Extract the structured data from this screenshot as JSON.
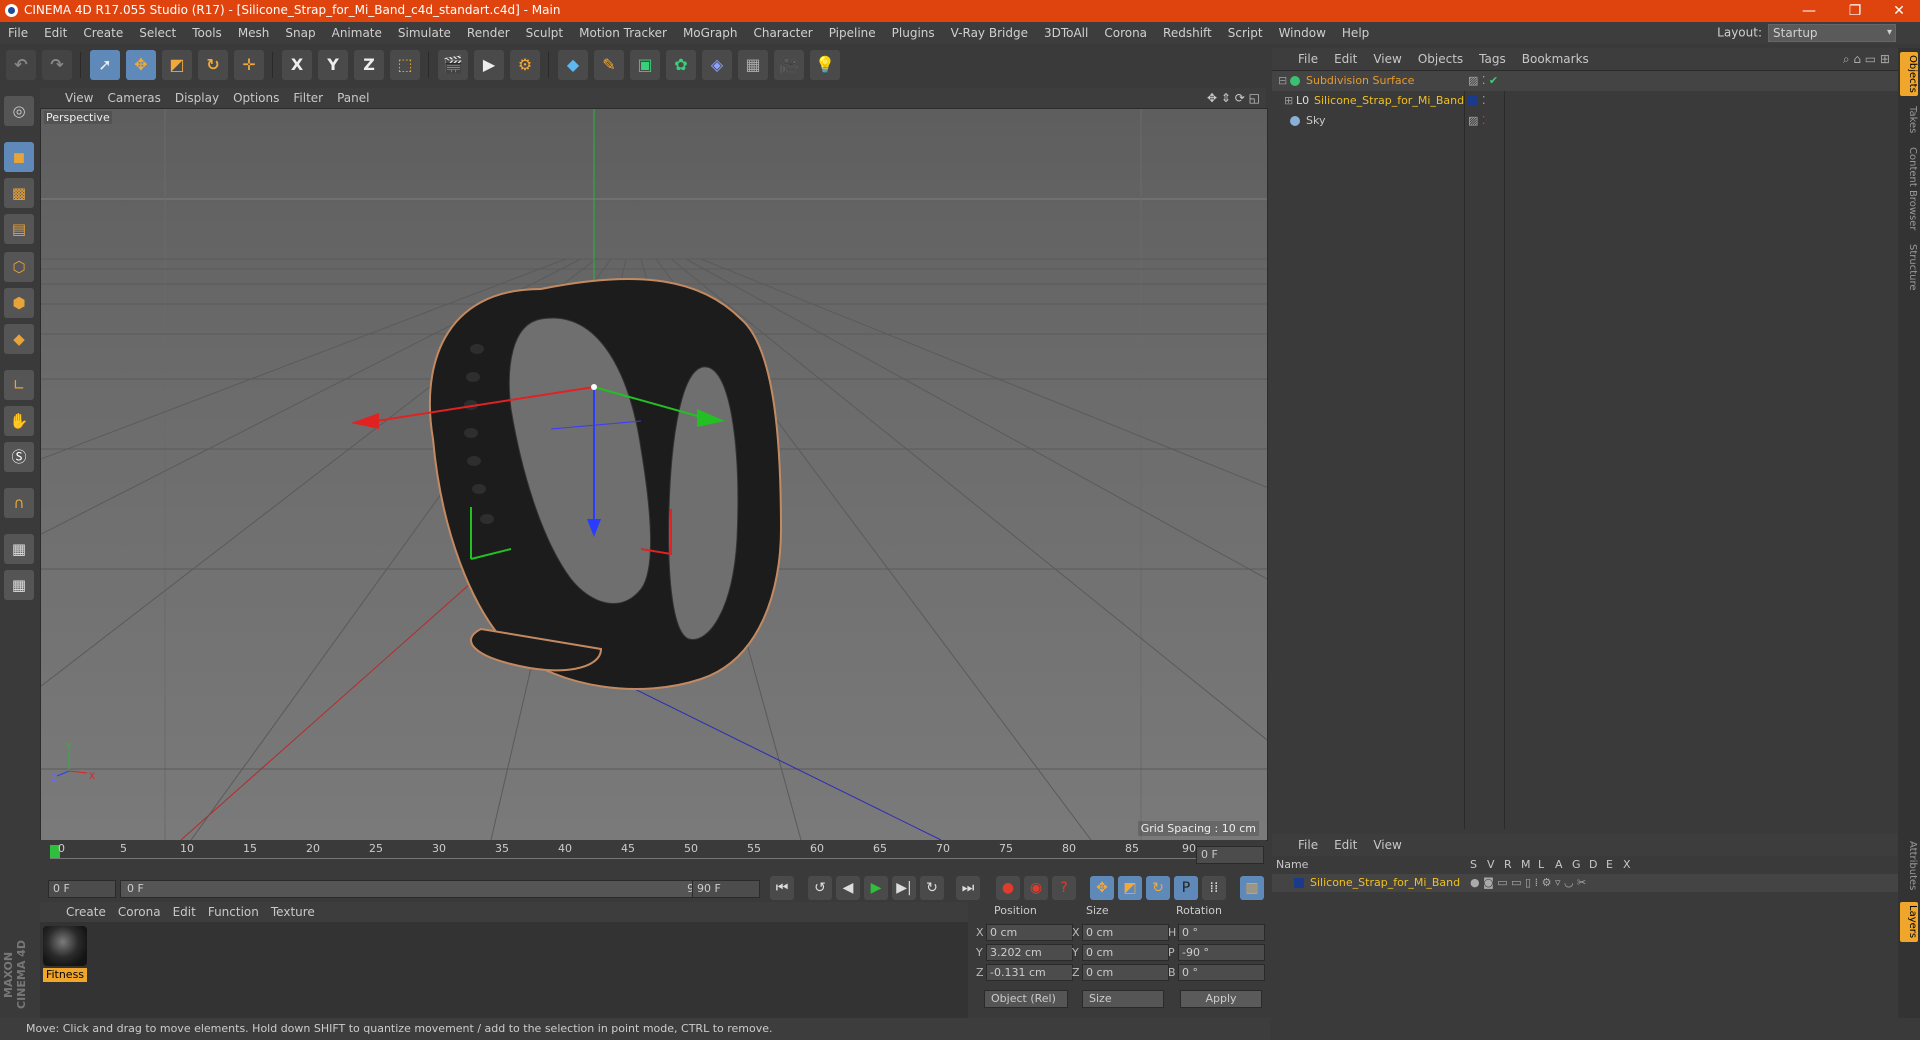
{
  "window": {
    "title": "CINEMA 4D R17.055 Studio (R17) - [Silicone_Strap_for_Mi_Band_c4d_standart.c4d] - Main",
    "controls": [
      "—",
      "❐",
      "✕"
    ]
  },
  "menubar": {
    "items": [
      "File",
      "Edit",
      "Create",
      "Select",
      "Tools",
      "Mesh",
      "Snap",
      "Animate",
      "Simulate",
      "Render",
      "Sculpt",
      "Motion Tracker",
      "MoGraph",
      "Character",
      "Pipeline",
      "Plugins",
      "V-Ray Bridge",
      "3DToAll",
      "Corona",
      "Redshift",
      "Script",
      "Window",
      "Help"
    ],
    "layout_label": "Layout:",
    "layout_value": "Startup"
  },
  "toolbar": {
    "icons": [
      "undo-icon",
      "redo-icon",
      "live-selection-icon",
      "move-icon",
      "scale-icon",
      "rotate-icon",
      "recent-tool-icon",
      "x-axis-icon",
      "y-axis-icon",
      "z-axis-icon",
      "world-coords-icon",
      "render-view-icon",
      "render-picture-viewer-icon",
      "edit-render-settings-icon",
      "cube-icon",
      "pen-spline-icon",
      "subdivision-icon",
      "array-icon",
      "deformer-icon",
      "floor-icon",
      "camera-icon",
      "light-icon"
    ],
    "axis_labels": [
      "X",
      "Y",
      "Z"
    ]
  },
  "viewport": {
    "menu": [
      "View",
      "Cameras",
      "Display",
      "Options",
      "Filter",
      "Panel"
    ],
    "camera_label": "Perspective",
    "grid_spacing": "Grid Spacing : 10 cm",
    "axis_labels": {
      "y": "Y",
      "x": "X",
      "z": "Z"
    }
  },
  "timeline": {
    "ticks": [
      "0",
      "5",
      "10",
      "15",
      "20",
      "25",
      "30",
      "35",
      "40",
      "45",
      "50",
      "55",
      "60",
      "65",
      "70",
      "75",
      "80",
      "85",
      "90"
    ],
    "current_frame": "0 F",
    "start_field": "0 F",
    "range_start": "0 F",
    "range_end": "90 F",
    "end_field": "90 F"
  },
  "materials": {
    "menu": [
      "Create",
      "Corona",
      "Edit",
      "Function",
      "Texture"
    ],
    "items": [
      {
        "name": "Fitness"
      }
    ]
  },
  "coordinates": {
    "headers": {
      "position": "Position",
      "size": "Size",
      "rotation": "Rotation"
    },
    "rows": [
      {
        "axis": "X",
        "pos": "0 cm",
        "size_axis": "X",
        "size": "0 cm",
        "rot_axis": "H",
        "rot": "0 °"
      },
      {
        "axis": "Y",
        "pos": "3.202 cm",
        "size_axis": "Y",
        "size": "0 cm",
        "rot_axis": "P",
        "rot": "-90 °"
      },
      {
        "axis": "Z",
        "pos": "-0.131 cm",
        "size_axis": "Z",
        "size": "0 cm",
        "rot_axis": "B",
        "rot": "0 °"
      }
    ],
    "mode": "Object (Rel)",
    "size_mode": "Size",
    "apply": "Apply"
  },
  "status": "Move: Click and drag to move elements. Hold down SHIFT to quantize movement / add to the selection in point mode, CTRL to remove.",
  "object_manager": {
    "menu": [
      "File",
      "Edit",
      "View",
      "Objects",
      "Tags",
      "Bookmarks"
    ],
    "objects": [
      {
        "name": "Subdivision Surface",
        "color": "#e89a2a"
      },
      {
        "name": "Silicone_Strap_for_Mi_Band",
        "color": "#f0c020"
      },
      {
        "name": "Sky",
        "color": "#c8c8c8"
      }
    ]
  },
  "layer_manager": {
    "menu": [
      "File",
      "Edit",
      "View"
    ],
    "columns": [
      "Name",
      "S",
      "V",
      "R",
      "M",
      "L",
      "A",
      "G",
      "D",
      "E",
      "X"
    ],
    "layers": [
      {
        "name": "Silicone_Strap_for_Mi_Band",
        "color": "#1c3a8a"
      }
    ]
  },
  "right_tabs": [
    "Objects",
    "Takes",
    "Content Browser",
    "Structure",
    "Attributes",
    "Layers"
  ],
  "maxon_logo": "MAXON CINEMA 4D",
  "colors": {
    "accent": "#e0440e",
    "highlight": "#f0a52b",
    "selected": "#5f89b8"
  }
}
